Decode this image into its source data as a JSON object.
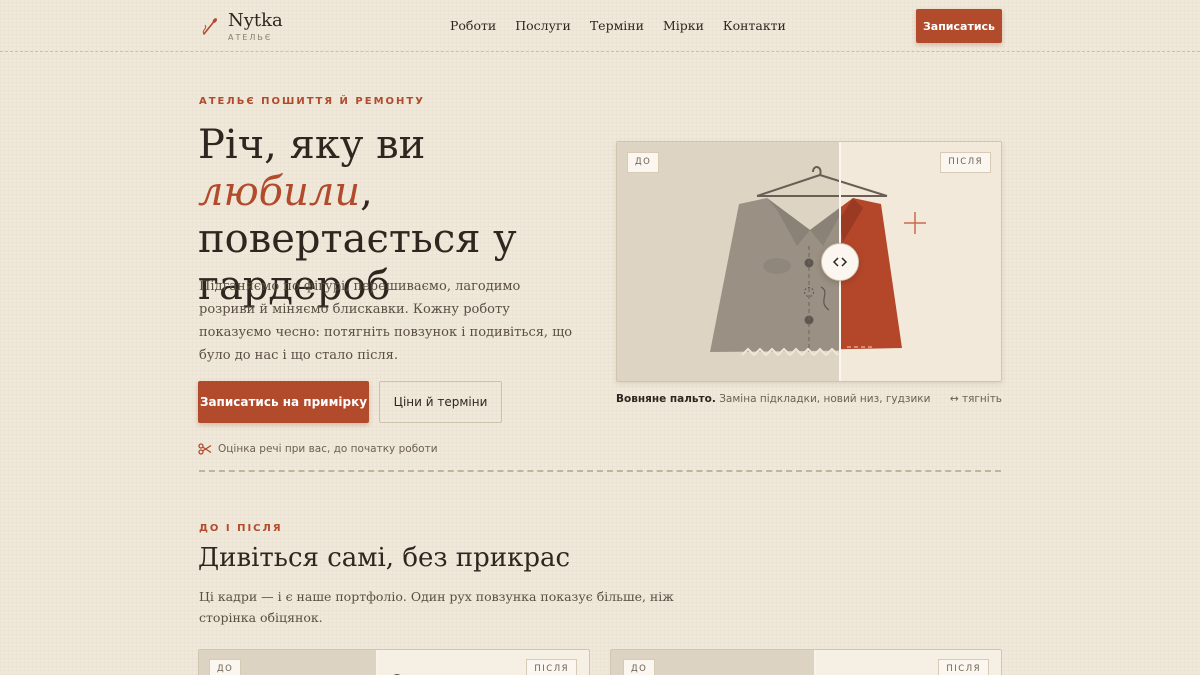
{
  "header": {
    "logo_name": "Nytka",
    "logo_sub": "АТЕЛЬЄ",
    "nav": [
      "Роботи",
      "Послуги",
      "Терміни",
      "Мірки",
      "Контакти"
    ],
    "cta": "Записатись"
  },
  "hero": {
    "eyebrow": "АТЕЛЬЄ ПОШИТТЯ Й РЕМОНТУ",
    "title_part1": "Річ, яку ви ",
    "title_accent": "любили",
    "title_part2": ", повертається у гардероб",
    "description": "Підганяємо по фігурі, перешиваємо, лагодимо розриви й міняємо блискавки. Кожну роботу показуємо чесно: потягніть повзунок і подивіться, що було до нас і що стало після.",
    "primary_button": "Записатись на примірку",
    "secondary_button": "Ціни й терміни",
    "hint": "Оцінка речі при вас, до початку роботи"
  },
  "compare": {
    "before_label": "ДО",
    "after_label": "ПІСЛЯ",
    "caption_bold": "Вовняне пальто.",
    "caption_rest": " Заміна підкладки, новий низ, гудзики",
    "drag_hint": "↔ тягніть",
    "split_fraction": 0.58
  },
  "section2": {
    "eyebrow": "ДО І ПІСЛЯ",
    "title": "Дивіться самі, без прикрас",
    "description": "Ці кадри — і є наше портфоліо. Один рух повзунка показує більше, ніж сторінка обіцянок."
  },
  "colors": {
    "accent": "#b24a2c",
    "background": "#f0e8da",
    "text": "#2f2620"
  }
}
